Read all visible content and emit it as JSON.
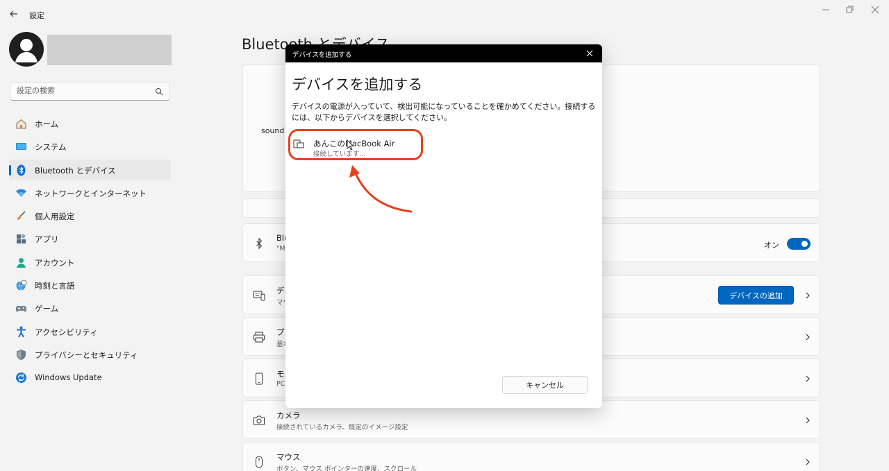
{
  "window": {
    "title": "設定"
  },
  "sidebar": {
    "search_placeholder": "設定の検索",
    "items": [
      {
        "label": "ホーム",
        "icon": "home-icon"
      },
      {
        "label": "システム",
        "icon": "system-icon"
      },
      {
        "label": "Bluetooth とデバイス",
        "icon": "bluetooth-icon",
        "selected": true
      },
      {
        "label": "ネットワークとインターネット",
        "icon": "wifi-icon"
      },
      {
        "label": "個人用設定",
        "icon": "brush-icon"
      },
      {
        "label": "アプリ",
        "icon": "apps-icon"
      },
      {
        "label": "アカウント",
        "icon": "account-icon"
      },
      {
        "label": "時刻と言語",
        "icon": "globe-clock-icon"
      },
      {
        "label": "ゲーム",
        "icon": "gamepad-icon"
      },
      {
        "label": "アクセシビリティ",
        "icon": "accessibility-icon"
      },
      {
        "label": "プライバシーとセキュリティ",
        "icon": "shield-icon"
      },
      {
        "label": "Windows Update",
        "icon": "update-icon"
      }
    ]
  },
  "main": {
    "page_title": "Bluetooth とデバイス",
    "device_card_name": "sound",
    "rows": {
      "bluetooth": {
        "title": "Blu",
        "subtitle": "\"M",
        "toggle_label": "オン",
        "toggle_on": true
      },
      "devices": {
        "title": "デバ",
        "subtitle": "マウ",
        "button_label": "デバイスの追加"
      },
      "printers": {
        "title": "プリ",
        "subtitle": "基本"
      },
      "mobile": {
        "title": "モバ",
        "subtitle": "PC"
      },
      "camera": {
        "title": "カメラ",
        "subtitle": "接続されているカメラ、既定のイメージ設定"
      },
      "mouse": {
        "title": "マウス",
        "subtitle": "ボタン、マウス ポインターの速度、スクロール"
      }
    }
  },
  "dialog": {
    "bar_title": "デバイスを追加する",
    "heading": "デバイスを追加する",
    "description": "デバイスの電源が入っていて、検出可能になっていることを確かめてください。接続するには、以下からデバイスを選択してください。",
    "device": {
      "name": "あんこのMacBook Air",
      "status": "接続しています..."
    },
    "cancel_label": "キャンセル"
  },
  "colors": {
    "accent": "#0067c0",
    "annotation": "#e8401c",
    "background": "#f3f3f3"
  }
}
